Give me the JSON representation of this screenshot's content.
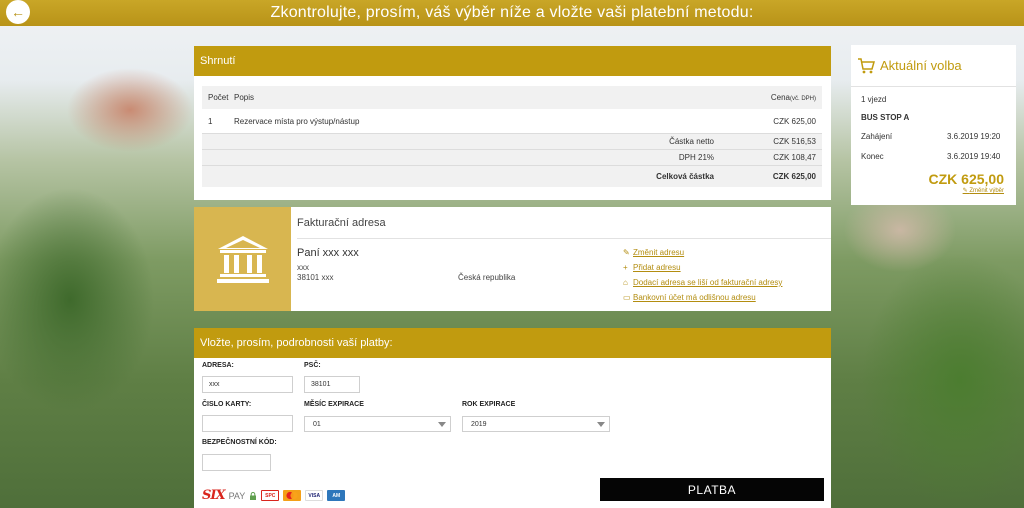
{
  "header": {
    "back_icon": "arrow-left-icon",
    "title": "Zkontrolujte, prosím, váš výběr níže a vložte vaši platební metodu:"
  },
  "summary": {
    "title": "Shrnutí",
    "columns": {
      "count": "Počet",
      "description": "Popis",
      "price": "Cena",
      "price_note": "(vč. DPH)"
    },
    "items": [
      {
        "count": "1",
        "description": "Rezervace místa pro výstup/nástup",
        "price": "CZK 625,00"
      }
    ],
    "totals": [
      {
        "label": "Částka netto",
        "value": "CZK 516,53"
      },
      {
        "label": "DPH 21%",
        "value": "CZK 108,47"
      }
    ],
    "grand_total": {
      "label": "Celková částka",
      "value": "CZK 625,00"
    }
  },
  "billing": {
    "title": "Fakturační adresa",
    "icon": "bank-icon",
    "name": "Paní xxx xxx",
    "street": "xxx",
    "city": "38101 xxx",
    "country": "Česká republika",
    "links": [
      {
        "icon": "edit-icon",
        "label": "Změnit adresu"
      },
      {
        "icon": "plus-icon",
        "label": "Přidat adresu"
      },
      {
        "icon": "home-icon",
        "label": "Dodací adresa se liší od fakturační adresy"
      },
      {
        "icon": "card-icon",
        "label": "Bankovní účet má odlišnou adresu"
      }
    ]
  },
  "payment": {
    "title": "Vložte, prosím, podrobnosti vaší platby:",
    "address_label": "ADRESA:",
    "address_value": "xxx",
    "zip_label": "PSČ:",
    "zip_value": "38101",
    "card_label": "ČISLO KARTY:",
    "card_value": "",
    "month_label": "MĚSÍC EXPIRACE",
    "month_value": "01",
    "year_label": "ROK EXPIRACE",
    "year_value": "2019",
    "cvv_label": "BEZPEČNOSTNÍ KÓD:",
    "cvv_value": "",
    "pay_button": "PLATBA",
    "provider_six": "SIX",
    "provider_pay": "PAY",
    "card_brands": [
      "SPC",
      "Mastercard",
      "VISA",
      "Amex"
    ]
  },
  "current": {
    "title": "Aktuální volba",
    "icon": "cart-icon",
    "trips": "1 vjezd",
    "stop": "BUS STOP A",
    "start_label": "Zahájení",
    "start_value": "3.6.2019 19:20",
    "end_label": "Konec",
    "end_value": "3.6.2019 19:40",
    "price": "CZK 625,00",
    "change_label": "Změnit výběr"
  }
}
